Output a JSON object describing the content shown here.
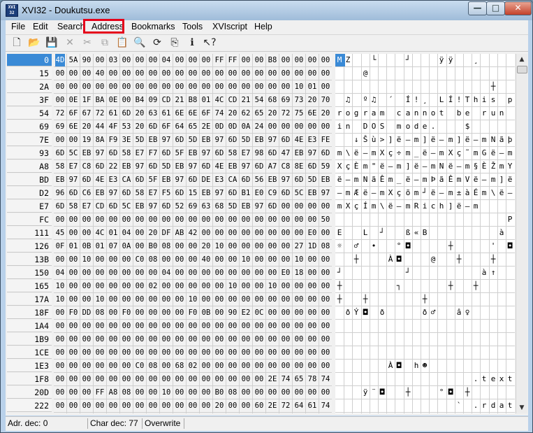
{
  "window": {
    "title": "XVI32 - Doukutsu.exe",
    "app_icon_text": "XVI 32"
  },
  "window_buttons": {
    "minimize": "—",
    "maximize": "□",
    "close": "✕"
  },
  "menu": [
    "File",
    "Edit",
    "Search",
    "Address",
    "Bookmarks",
    "Tools",
    "XVIscript",
    "Help"
  ],
  "toolbar": [
    "new-file-icon",
    "open-folder-icon",
    "save-icon",
    "delete-icon",
    "cut-icon",
    "copy-icon",
    "paste-icon",
    "find-icon",
    "replace-icon",
    "goto-icon",
    "script-icon",
    "help-icon"
  ],
  "toolbar_glyphs": [
    "🗋",
    "📂",
    "💾",
    "✕",
    "✂",
    "⧉",
    "📋",
    "🔍",
    "⟳",
    "⎘",
    "ℹ",
    "↖?"
  ],
  "addresses": [
    "0",
    "15",
    "2A",
    "3F",
    "54",
    "69",
    "7E",
    "93",
    "A8",
    "BD",
    "D2",
    "E7",
    "FC",
    "111",
    "126",
    "13B",
    "150",
    "165",
    "17A",
    "18F",
    "1A4",
    "1B9",
    "1CE",
    "1E3",
    "1F8",
    "20D",
    "222"
  ],
  "hex_rows": [
    [
      "4D",
      "5A",
      "90",
      "00",
      "03",
      "00",
      "00",
      "00",
      "04",
      "00",
      "00",
      "00",
      "FF",
      "FF",
      "00",
      "00",
      "B8",
      "00",
      "00",
      "00",
      "00"
    ],
    [
      "00",
      "00",
      "00",
      "40",
      "00",
      "00",
      "00",
      "00",
      "00",
      "00",
      "00",
      "00",
      "00",
      "00",
      "00",
      "00",
      "00",
      "00",
      "00",
      "00",
      "00"
    ],
    [
      "00",
      "00",
      "00",
      "00",
      "00",
      "00",
      "00",
      "00",
      "00",
      "00",
      "00",
      "00",
      "00",
      "00",
      "00",
      "00",
      "00",
      "00",
      "10",
      "01",
      "00"
    ],
    [
      "00",
      "0E",
      "1F",
      "BA",
      "0E",
      "00",
      "B4",
      "09",
      "CD",
      "21",
      "B8",
      "01",
      "4C",
      "CD",
      "21",
      "54",
      "68",
      "69",
      "73",
      "20",
      "70"
    ],
    [
      "72",
      "6F",
      "67",
      "72",
      "61",
      "6D",
      "20",
      "63",
      "61",
      "6E",
      "6E",
      "6F",
      "74",
      "20",
      "62",
      "65",
      "20",
      "72",
      "75",
      "6E",
      "20"
    ],
    [
      "69",
      "6E",
      "20",
      "44",
      "4F",
      "53",
      "20",
      "6D",
      "6F",
      "64",
      "65",
      "2E",
      "0D",
      "0D",
      "0A",
      "24",
      "00",
      "00",
      "00",
      "00",
      "00"
    ],
    [
      "00",
      "00",
      "19",
      "8A",
      "F9",
      "3E",
      "5D",
      "EB",
      "97",
      "6D",
      "5D",
      "EB",
      "97",
      "6D",
      "5D",
      "EB",
      "97",
      "6D",
      "4E",
      "E3",
      "FE"
    ],
    [
      "6D",
      "5C",
      "EB",
      "97",
      "6D",
      "58",
      "E7",
      "F7",
      "6D",
      "5F",
      "EB",
      "97",
      "6D",
      "58",
      "E7",
      "98",
      "6D",
      "47",
      "EB",
      "97",
      "6D"
    ],
    [
      "58",
      "E7",
      "C8",
      "6D",
      "22",
      "EB",
      "97",
      "6D",
      "5D",
      "EB",
      "97",
      "6D",
      "4E",
      "EB",
      "97",
      "6D",
      "A7",
      "C8",
      "8E",
      "6D",
      "59"
    ],
    [
      "EB",
      "97",
      "6D",
      "4E",
      "E3",
      "CA",
      "6D",
      "5F",
      "EB",
      "97",
      "6D",
      "DE",
      "E3",
      "CA",
      "6D",
      "56",
      "EB",
      "97",
      "6D",
      "5D",
      "EB"
    ],
    [
      "96",
      "6D",
      "C6",
      "EB",
      "97",
      "6D",
      "58",
      "E7",
      "F5",
      "6D",
      "15",
      "EB",
      "97",
      "6D",
      "B1",
      "E0",
      "C9",
      "6D",
      "5C",
      "EB",
      "97"
    ],
    [
      "6D",
      "58",
      "E7",
      "CD",
      "6D",
      "5C",
      "EB",
      "97",
      "6D",
      "52",
      "69",
      "63",
      "68",
      "5D",
      "EB",
      "97",
      "6D",
      "00",
      "00",
      "00",
      "00"
    ],
    [
      "00",
      "00",
      "00",
      "00",
      "00",
      "00",
      "00",
      "00",
      "00",
      "00",
      "00",
      "00",
      "00",
      "00",
      "00",
      "00",
      "00",
      "00",
      "00",
      "00",
      "50"
    ],
    [
      "45",
      "00",
      "00",
      "4C",
      "01",
      "04",
      "00",
      "20",
      "DF",
      "AB",
      "42",
      "00",
      "00",
      "00",
      "00",
      "00",
      "00",
      "00",
      "00",
      "E0",
      "00"
    ],
    [
      "0F",
      "01",
      "0B",
      "01",
      "07",
      "0A",
      "00",
      "B0",
      "08",
      "00",
      "00",
      "20",
      "10",
      "00",
      "00",
      "00",
      "00",
      "00",
      "27",
      "1D",
      "08"
    ],
    [
      "00",
      "00",
      "10",
      "00",
      "00",
      "00",
      "C0",
      "08",
      "00",
      "00",
      "00",
      "40",
      "00",
      "00",
      "10",
      "00",
      "00",
      "00",
      "10",
      "00",
      "00"
    ],
    [
      "04",
      "00",
      "00",
      "00",
      "00",
      "00",
      "00",
      "00",
      "04",
      "00",
      "00",
      "00",
      "00",
      "00",
      "00",
      "00",
      "00",
      "E0",
      "18",
      "00",
      "00"
    ],
    [
      "10",
      "00",
      "00",
      "00",
      "00",
      "00",
      "00",
      "02",
      "00",
      "00",
      "00",
      "00",
      "00",
      "10",
      "00",
      "00",
      "10",
      "00",
      "00",
      "00",
      "00"
    ],
    [
      "10",
      "00",
      "00",
      "10",
      "00",
      "00",
      "00",
      "00",
      "00",
      "00",
      "10",
      "00",
      "00",
      "00",
      "00",
      "00",
      "00",
      "00",
      "00",
      "00",
      "00"
    ],
    [
      "00",
      "F0",
      "DD",
      "08",
      "00",
      "F0",
      "00",
      "00",
      "00",
      "00",
      "F0",
      "0B",
      "00",
      "90",
      "E2",
      "0C",
      "00",
      "00",
      "00",
      "00",
      "00"
    ],
    [
      "00",
      "00",
      "00",
      "00",
      "00",
      "00",
      "00",
      "00",
      "00",
      "00",
      "00",
      "00",
      "00",
      "00",
      "00",
      "00",
      "00",
      "00",
      "00",
      "00",
      "00"
    ],
    [
      "00",
      "00",
      "00",
      "00",
      "00",
      "00",
      "00",
      "00",
      "00",
      "00",
      "00",
      "00",
      "00",
      "00",
      "00",
      "00",
      "00",
      "00",
      "00",
      "00",
      "00"
    ],
    [
      "00",
      "00",
      "00",
      "00",
      "00",
      "00",
      "00",
      "00",
      "00",
      "00",
      "00",
      "00",
      "00",
      "00",
      "00",
      "00",
      "00",
      "00",
      "00",
      "00",
      "00"
    ],
    [
      "00",
      "00",
      "00",
      "00",
      "00",
      "00",
      "C0",
      "08",
      "00",
      "68",
      "02",
      "00",
      "00",
      "00",
      "00",
      "00",
      "00",
      "00",
      "00",
      "00",
      "00"
    ],
    [
      "00",
      "00",
      "00",
      "00",
      "00",
      "00",
      "00",
      "00",
      "00",
      "00",
      "00",
      "00",
      "00",
      "00",
      "00",
      "00",
      "2E",
      "74",
      "65",
      "78",
      "74"
    ],
    [
      "00",
      "00",
      "00",
      "FF",
      "A8",
      "08",
      "00",
      "00",
      "10",
      "00",
      "00",
      "00",
      "B0",
      "08",
      "00",
      "00",
      "00",
      "00",
      "00",
      "00",
      "00"
    ],
    [
      "00",
      "00",
      "00",
      "00",
      "00",
      "00",
      "00",
      "00",
      "00",
      "00",
      "00",
      "00",
      "20",
      "00",
      "00",
      "60",
      "2E",
      "72",
      "64",
      "61",
      "74"
    ]
  ],
  "char_rows": [
    [
      "M",
      "Z",
      "",
      "",
      "└",
      "",
      "",
      "",
      "┘",
      "",
      "",
      "",
      "ÿ",
      "ÿ",
      "",
      "",
      "¸",
      "",
      "",
      "",
      ""
    ],
    [
      "",
      "",
      "",
      "@",
      "",
      "",
      "",
      "",
      "",
      "",
      "",
      "",
      "",
      "",
      "",
      "",
      "",
      "",
      "",
      "",
      ""
    ],
    [
      "",
      "",
      "",
      "",
      "",
      "",
      "",
      "",
      "",
      "",
      "",
      "",
      "",
      "",
      "",
      "",
      "",
      "",
      "┼",
      "",
      ""
    ],
    [
      "",
      "♫",
      "",
      "º",
      "♫",
      "",
      "´",
      "",
      "Í",
      "!",
      "¸",
      "",
      "L",
      "Í",
      "!",
      "T",
      "h",
      "i",
      "s",
      "",
      "p"
    ],
    [
      "r",
      "o",
      "g",
      "r",
      "a",
      "m",
      "",
      "c",
      "a",
      "n",
      "n",
      "o",
      "t",
      "",
      "b",
      "e",
      "",
      "r",
      "u",
      "n",
      ""
    ],
    [
      "i",
      "n",
      "",
      "D",
      "O",
      "S",
      "",
      "m",
      "o",
      "d",
      "e",
      ".",
      "",
      "",
      "",
      "$",
      "",
      "",
      "",
      "",
      ""
    ],
    [
      "",
      "",
      "↓",
      "Š",
      "ù",
      ">",
      "]",
      "ë",
      "—",
      "m",
      "]",
      "ë",
      "—",
      "m",
      "]",
      "ë",
      "—",
      "m",
      "N",
      "ã",
      "þ"
    ],
    [
      "m",
      "\\",
      "ë",
      "—",
      "m",
      "X",
      "ç",
      "÷",
      "m",
      "_",
      "ë",
      "—",
      "m",
      "X",
      "ç",
      "˜",
      "m",
      "G",
      "ë",
      "—",
      "m"
    ],
    [
      "X",
      "ç",
      "È",
      "m",
      "\"",
      "ë",
      "—",
      "m",
      "]",
      "ë",
      "—",
      "m",
      "N",
      "ë",
      "—",
      "m",
      "§",
      "È",
      "Ž",
      "m",
      "Y"
    ],
    [
      "ë",
      "—",
      "m",
      "N",
      "ã",
      "Ê",
      "m",
      "_",
      "ë",
      "—",
      "m",
      "Þ",
      "ã",
      "Ê",
      "m",
      "V",
      "ë",
      "—",
      "m",
      "]",
      "ë"
    ],
    [
      "–",
      "m",
      "Æ",
      "ë",
      "—",
      "m",
      "X",
      "ç",
      "õ",
      "m",
      "┘",
      "ë",
      "—",
      "m",
      "±",
      "à",
      "É",
      "m",
      "\\",
      "ë",
      "—"
    ],
    [
      "m",
      "X",
      "ç",
      "Í",
      "m",
      "\\",
      "ë",
      "—",
      "m",
      "R",
      "i",
      "c",
      "h",
      "]",
      "ë",
      "—",
      "m",
      "",
      "",
      "",
      ""
    ],
    [
      "",
      "",
      "",
      "",
      "",
      "",
      "",
      "",
      "",
      "",
      "",
      "",
      "",
      "",
      "",
      "",
      "",
      "",
      "",
      "",
      "P"
    ],
    [
      "E",
      "",
      "",
      "L",
      "",
      "┘",
      "",
      "",
      "ß",
      "«",
      "B",
      "",
      "",
      "",
      "",
      "",
      "",
      "",
      "",
      "à",
      ""
    ],
    [
      "☼",
      "",
      "♂",
      "",
      "•",
      "",
      "",
      "°",
      "◘",
      "",
      "",
      "",
      "",
      "┼",
      "",
      "",
      "",
      "",
      "'",
      "",
      "◘"
    ],
    [
      "",
      "",
      "┼",
      "",
      "",
      "",
      "À",
      "◘",
      "",
      "",
      "",
      "@",
      "",
      "",
      "┼",
      "",
      "",
      "",
      "┼",
      "",
      ""
    ],
    [
      "┘",
      "",
      "",
      "",
      "",
      "",
      "",
      "",
      "┘",
      "",
      "",
      "",
      "",
      "",
      "",
      "",
      "",
      "à",
      "↑",
      "",
      ""
    ],
    [
      "┼",
      "",
      "",
      "",
      "",
      "",
      "",
      "┐",
      "",
      "",
      "",
      "",
      "",
      "┼",
      "",
      "",
      "┼",
      "",
      "",
      "",
      ""
    ],
    [
      "┼",
      "",
      "",
      "┼",
      "",
      "",
      "",
      "",
      "",
      "",
      "┼",
      "",
      "",
      "",
      "",
      "",
      "",
      "",
      "",
      "",
      ""
    ],
    [
      "",
      "ð",
      "Ý",
      "◘",
      "",
      "ð",
      "",
      "",
      "",
      "",
      "ð",
      "♂",
      "",
      "",
      "â",
      "♀",
      "",
      "",
      "",
      "",
      ""
    ],
    [
      "",
      "",
      "",
      "",
      "",
      "",
      "",
      "",
      "",
      "",
      "",
      "",
      "",
      "",
      "",
      "",
      "",
      "",
      "",
      "",
      ""
    ],
    [
      "",
      "",
      "",
      "",
      "",
      "",
      "",
      "",
      "",
      "",
      "",
      "",
      "",
      "",
      "",
      "",
      "",
      "",
      "",
      "",
      ""
    ],
    [
      "",
      "",
      "",
      "",
      "",
      "",
      "",
      "",
      "",
      "",
      "",
      "",
      "",
      "",
      "",
      "",
      "",
      "",
      "",
      "",
      ""
    ],
    [
      "",
      "",
      "",
      "",
      "",
      "",
      "À",
      "◘",
      "",
      "h",
      "☻",
      "",
      "",
      "",
      "",
      "",
      "",
      "",
      "",
      "",
      ""
    ],
    [
      "",
      "",
      "",
      "",
      "",
      "",
      "",
      "",
      "",
      "",
      "",
      "",
      "",
      "",
      "",
      "",
      ".",
      "t",
      "e",
      "x",
      "t"
    ],
    [
      "",
      "",
      "",
      "ÿ",
      "¨",
      "◘",
      "",
      "",
      "┼",
      "",
      "",
      "",
      "°",
      "◘",
      "",
      "┼",
      "",
      "",
      "",
      "",
      ""
    ],
    [
      "",
      "",
      "",
      "",
      "",
      "",
      "",
      "",
      "",
      "",
      "",
      "",
      "",
      "",
      "`",
      "",
      ".",
      "r",
      "d",
      "a",
      "t"
    ]
  ],
  "scrollbar": {
    "up": "▲",
    "down": "▼"
  },
  "status": {
    "address": "Adr. dec: 0",
    "char": "Char dec: 77",
    "mode": "Overwrite"
  }
}
